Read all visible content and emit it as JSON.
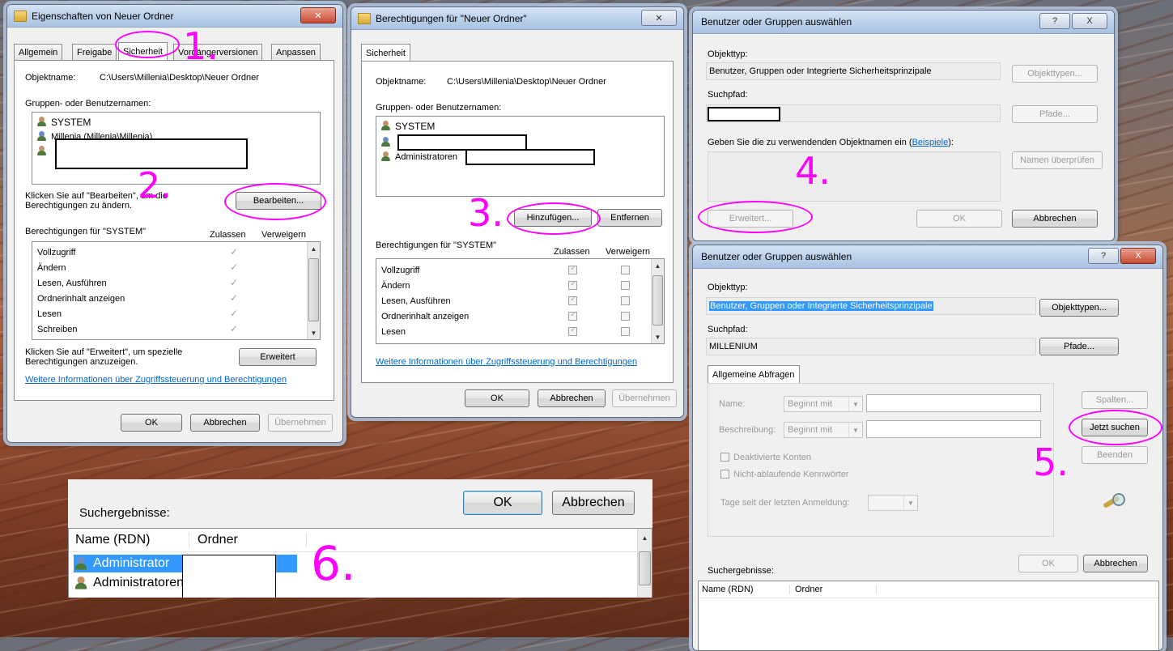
{
  "win1": {
    "title": "Eigenschaften von Neuer Ordner",
    "tabs": [
      "Allgemein",
      "Freigabe",
      "Sicherheit",
      "Vorgängerversionen",
      "Anpassen"
    ],
    "object_name_label": "Objektname:",
    "object_name_value": "C:\\Users\\Millenia\\Desktop\\Neuer Ordner",
    "groups_label": "Gruppen- oder Benutzernamen:",
    "users": [
      "SYSTEM",
      "Millenia (Millenia\\Millenia)"
    ],
    "edit_hint": "Klicken Sie auf \"Bearbeiten\", um die Berechtigungen zu ändern.",
    "edit_button": "Bearbeiten...",
    "perms_for": "Berechtigungen für \"SYSTEM\"",
    "allow_label": "Zulassen",
    "deny_label": "Verweigern",
    "permissions": [
      "Vollzugriff",
      "Ändern",
      "Lesen, Ausführen",
      "Ordnerinhalt anzeigen",
      "Lesen",
      "Schreiben"
    ],
    "advanced_hint": "Klicken Sie auf \"Erweitert\", um spezielle Berechtigungen anzuzeigen.",
    "advanced_button": "Erweitert",
    "info_link": "Weitere Informationen über Zugriffssteuerung und Berechtigungen",
    "ok": "OK",
    "cancel": "Abbrechen",
    "apply": "Übernehmen"
  },
  "win2": {
    "title": "Berechtigungen für \"Neuer Ordner\"",
    "tab": "Sicherheit",
    "object_name_label": "Objektname:",
    "object_name_value": "C:\\Users\\Millenia\\Desktop\\Neuer Ordner",
    "groups_label": "Gruppen- oder Benutzernamen:",
    "users": [
      "SYSTEM",
      "Administratoren"
    ],
    "add_button": "Hinzufügen...",
    "remove_button": "Entfernen",
    "perms_for": "Berechtigungen für \"SYSTEM\"",
    "allow_label": "Zulassen",
    "deny_label": "Verweigern",
    "permissions": [
      "Vollzugriff",
      "Ändern",
      "Lesen, Ausführen",
      "Ordnerinhalt anzeigen",
      "Lesen"
    ],
    "info_link": "Weitere Informationen über Zugriffssteuerung und Berechtigungen",
    "ok": "OK",
    "cancel": "Abbrechen",
    "apply": "Übernehmen"
  },
  "win3": {
    "title": "Benutzer oder Gruppen auswählen",
    "object_type_label": "Objekttyp:",
    "object_type_value": "Benutzer, Gruppen oder Integrierte Sicherheitsprinzipale",
    "object_types_button": "Objekttypen...",
    "search_path_label": "Suchpfad:",
    "paths_button": "Pfade...",
    "enter_names_label": "Geben Sie die zu verwendenden Objektnamen ein (",
    "examples_link": "Beispiele",
    "enter_names_suffix": "):",
    "check_names_button": "Namen überprüfen",
    "advanced_button": "Erweitert...",
    "ok": "OK",
    "cancel": "Abbrechen",
    "help": "?",
    "close": "X"
  },
  "win4": {
    "title": "Benutzer oder Gruppen auswählen",
    "object_type_label": "Objekttyp:",
    "object_type_value": "Benutzer, Gruppen oder Integrierte Sicherheitsprinzipale",
    "object_types_button": "Objekttypen...",
    "search_path_label": "Suchpfad:",
    "search_path_value": "MILLENIUM",
    "paths_button": "Pfade...",
    "tab": "Allgemeine Abfragen",
    "name_label": "Name:",
    "name_combo": "Beginnt mit",
    "desc_label": "Beschreibung:",
    "desc_combo": "Beginnt mit",
    "disabled_accounts": "Deaktivierte Konten",
    "non_expiring": "Nicht-ablaufende Kennwörter",
    "days_label": "Tage seit der letzten Anmeldung:",
    "columns_button": "Spalten...",
    "search_now_button": "Jetzt suchen",
    "stop_button": "Beenden",
    "results_label": "Suchergebnisse:",
    "ok": "OK",
    "cancel": "Abbrechen",
    "col_name": "Name (RDN)",
    "col_folder": "Ordner",
    "help": "?",
    "close": "X"
  },
  "zoom": {
    "ok": "OK",
    "cancel": "Abbrechen",
    "results_label": "Suchergebnisse:",
    "col_name": "Name (RDN)",
    "col_folder": "Ordner",
    "rows": [
      "Administrator",
      "Administratoren"
    ]
  },
  "annotations": {
    "a1": "1.",
    "a2": "2.",
    "a3": "3.",
    "a4": "4.",
    "a5": "5.",
    "a6": "6."
  },
  "colors": {
    "annotation": "#ff00ff",
    "selection": "#3399ff"
  }
}
